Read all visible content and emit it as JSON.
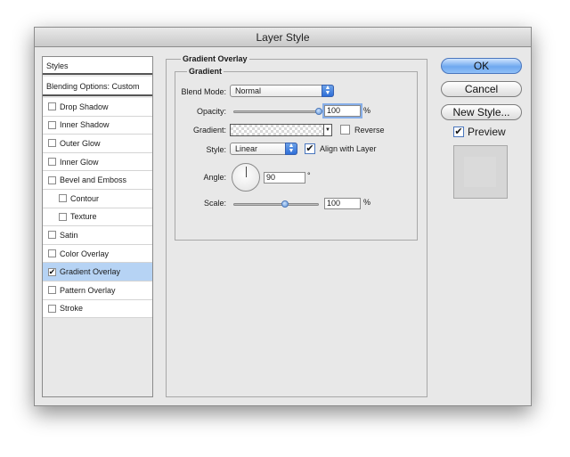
{
  "window": {
    "title": "Layer Style"
  },
  "styles_list": {
    "header": "Styles",
    "blending_options": "Blending Options: Custom",
    "items": [
      {
        "label": "Drop Shadow",
        "checked": false,
        "sub": false,
        "selected": false
      },
      {
        "label": "Inner Shadow",
        "checked": false,
        "sub": false,
        "selected": false
      },
      {
        "label": "Outer Glow",
        "checked": false,
        "sub": false,
        "selected": false
      },
      {
        "label": "Inner Glow",
        "checked": false,
        "sub": false,
        "selected": false
      },
      {
        "label": "Bevel and Emboss",
        "checked": false,
        "sub": false,
        "selected": false
      },
      {
        "label": "Contour",
        "checked": false,
        "sub": true,
        "selected": false
      },
      {
        "label": "Texture",
        "checked": false,
        "sub": true,
        "selected": false
      },
      {
        "label": "Satin",
        "checked": false,
        "sub": false,
        "selected": false
      },
      {
        "label": "Color Overlay",
        "checked": false,
        "sub": false,
        "selected": false
      },
      {
        "label": "Gradient Overlay",
        "checked": true,
        "sub": false,
        "selected": true
      },
      {
        "label": "Pattern Overlay",
        "checked": false,
        "sub": false,
        "selected": false
      },
      {
        "label": "Stroke",
        "checked": false,
        "sub": false,
        "selected": false
      }
    ]
  },
  "panel": {
    "title": "Gradient Overlay",
    "section_title": "Gradient",
    "blend_mode": {
      "label": "Blend Mode:",
      "value": "Normal"
    },
    "opacity": {
      "label": "Opacity:",
      "value": "100",
      "unit": "%",
      "level": 1.0
    },
    "gradient": {
      "label": "Gradient:",
      "reverse_label": "Reverse",
      "reverse_checked": false
    },
    "style": {
      "label": "Style:",
      "value": "Linear",
      "align_label": "Align with Layer",
      "align_checked": true
    },
    "angle": {
      "label": "Angle:",
      "value": "90",
      "unit": "°"
    },
    "scale": {
      "label": "Scale:",
      "value": "100",
      "unit": "%",
      "level": 0.6
    }
  },
  "buttons": {
    "ok": "OK",
    "cancel": "Cancel",
    "new_style": "New Style...",
    "preview_label": "Preview",
    "preview_checked": true
  },
  "colors": {
    "selection": "#b6d3f4",
    "accent_blue": "#2e6ed8"
  },
  "icons": {
    "select_arrows": "updown-arrows-icon",
    "checkmark": "checkmark-icon"
  }
}
